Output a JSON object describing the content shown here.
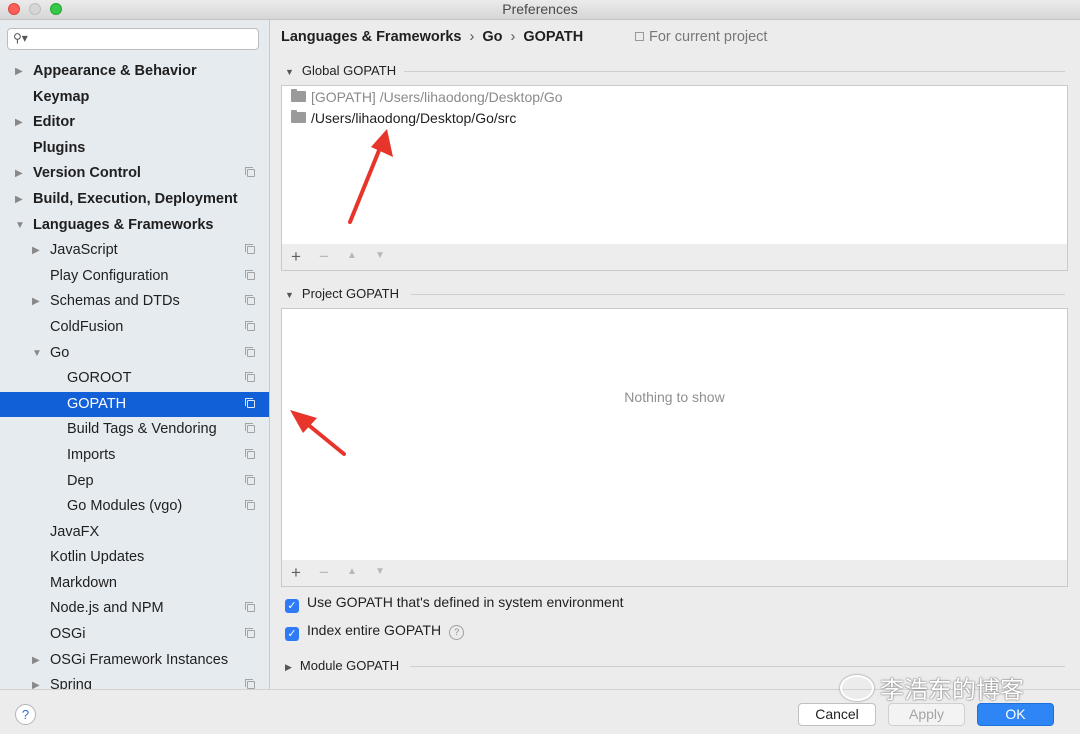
{
  "window": {
    "title": "Preferences"
  },
  "sidebar": {
    "search_value": "",
    "items": [
      {
        "label": "Appearance & Behavior",
        "level": 0,
        "bold": true,
        "arrow": "right",
        "copy": false,
        "selected": false
      },
      {
        "label": "Keymap",
        "level": 0,
        "bold": true,
        "arrow": "none",
        "copy": false,
        "selected": false
      },
      {
        "label": "Editor",
        "level": 0,
        "bold": true,
        "arrow": "right",
        "copy": false,
        "selected": false
      },
      {
        "label": "Plugins",
        "level": 0,
        "bold": true,
        "arrow": "none",
        "copy": false,
        "selected": false
      },
      {
        "label": "Version Control",
        "level": 0,
        "bold": true,
        "arrow": "right",
        "copy": true,
        "selected": false
      },
      {
        "label": "Build, Execution, Deployment",
        "level": 0,
        "bold": true,
        "arrow": "right",
        "copy": false,
        "selected": false
      },
      {
        "label": "Languages & Frameworks",
        "level": 0,
        "bold": true,
        "arrow": "down",
        "copy": false,
        "selected": false
      },
      {
        "label": "JavaScript",
        "level": 1,
        "bold": false,
        "arrow": "right",
        "copy": true,
        "selected": false
      },
      {
        "label": "Play Configuration",
        "level": 1,
        "bold": false,
        "arrow": "none",
        "copy": true,
        "selected": false
      },
      {
        "label": "Schemas and DTDs",
        "level": 1,
        "bold": false,
        "arrow": "right",
        "copy": true,
        "selected": false
      },
      {
        "label": "ColdFusion",
        "level": 1,
        "bold": false,
        "arrow": "none",
        "copy": true,
        "selected": false
      },
      {
        "label": "Go",
        "level": 1,
        "bold": false,
        "arrow": "down",
        "copy": true,
        "selected": false
      },
      {
        "label": "GOROOT",
        "level": 2,
        "bold": false,
        "arrow": "none",
        "copy": true,
        "selected": false
      },
      {
        "label": "GOPATH",
        "level": 2,
        "bold": false,
        "arrow": "none",
        "copy": true,
        "selected": true
      },
      {
        "label": "Build Tags & Vendoring",
        "level": 2,
        "bold": false,
        "arrow": "none",
        "copy": true,
        "selected": false
      },
      {
        "label": "Imports",
        "level": 2,
        "bold": false,
        "arrow": "none",
        "copy": true,
        "selected": false
      },
      {
        "label": "Dep",
        "level": 2,
        "bold": false,
        "arrow": "none",
        "copy": true,
        "selected": false
      },
      {
        "label": "Go Modules (vgo)",
        "level": 2,
        "bold": false,
        "arrow": "none",
        "copy": true,
        "selected": false
      },
      {
        "label": "JavaFX",
        "level": 1,
        "bold": false,
        "arrow": "none",
        "copy": false,
        "selected": false
      },
      {
        "label": "Kotlin Updates",
        "level": 1,
        "bold": false,
        "arrow": "none",
        "copy": false,
        "selected": false
      },
      {
        "label": "Markdown",
        "level": 1,
        "bold": false,
        "arrow": "none",
        "copy": false,
        "selected": false
      },
      {
        "label": "Node.js and NPM",
        "level": 1,
        "bold": false,
        "arrow": "none",
        "copy": true,
        "selected": false
      },
      {
        "label": "OSGi",
        "level": 1,
        "bold": false,
        "arrow": "none",
        "copy": true,
        "selected": false
      },
      {
        "label": "OSGi Framework Instances",
        "level": 1,
        "bold": false,
        "arrow": "right",
        "copy": false,
        "selected": false
      },
      {
        "label": "Spring",
        "level": 1,
        "bold": false,
        "arrow": "right",
        "copy": true,
        "selected": false
      }
    ]
  },
  "breadcrumb": {
    "part1": "Languages & Frameworks",
    "part2": "Go",
    "part3": "GOPATH",
    "separator": "›"
  },
  "scope_label": "For current project",
  "global_gopath": {
    "title": "Global GOPATH",
    "entries": [
      {
        "text": "[GOPATH] /Users/lihaodong/Desktop/Go"
      },
      {
        "text": "/Users/lihaodong/Desktop/Go/src"
      }
    ]
  },
  "project_gopath": {
    "title": "Project GOPATH",
    "empty_text": "Nothing to show"
  },
  "toolbar": {
    "add": "+",
    "remove": "−",
    "up": "▲",
    "down": "▼"
  },
  "options": {
    "use_system_gopath": {
      "label": "Use GOPATH that's defined in system environment",
      "checked": true
    },
    "index_entire_gopath": {
      "label": "Index entire GOPATH",
      "checked": true
    }
  },
  "module_gopath": {
    "title": "Module GOPATH"
  },
  "footer": {
    "help": "?",
    "cancel": "Cancel",
    "apply": "Apply",
    "ok": "OK"
  },
  "watermark": {
    "text": "李浩东的博客"
  },
  "colors": {
    "selection": "#1260d8",
    "ok_button": "#2e85f5",
    "annotation_arrow": "#e8352b"
  }
}
